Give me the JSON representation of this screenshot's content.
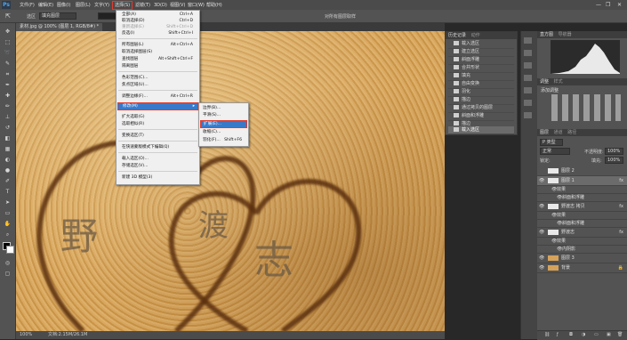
{
  "menubar": {
    "logo": "Ps",
    "items": [
      "文件(F)",
      "编辑(E)",
      "图像(I)",
      "图层(L)",
      "文字(Y)",
      "选择(S)",
      "滤镜(T)",
      "3D(D)",
      "视图(V)",
      "窗口(W)",
      "帮助(H)"
    ],
    "active": "选择(S)",
    "controls": [
      "—",
      "❐",
      "✕"
    ]
  },
  "options": {
    "style_label": "选区",
    "style_value": "填充图层",
    "extra": "对所有图层取样"
  },
  "document": {
    "tab": "素材.jpg @ 100% (图层 1, RGB/8#) *",
    "zoom": "100%",
    "info": "文档:2.15M/26.1M"
  },
  "select_menu": {
    "items": [
      {
        "label": "全部(A)",
        "shortcut": "Ctrl+A"
      },
      {
        "label": "取消选择(D)",
        "shortcut": "Ctrl+D"
      },
      {
        "label": "重新选择(E)",
        "shortcut": "Shift+Ctrl+D",
        "disabled": true
      },
      {
        "label": "反选(I)",
        "shortcut": "Shift+Ctrl+I"
      },
      {
        "label": "所有图层(L)",
        "shortcut": "Alt+Ctrl+A"
      },
      {
        "label": "取消选择图层(S)",
        "shortcut": ""
      },
      {
        "label": "查找图层",
        "shortcut": "Alt+Shift+Ctrl+F"
      },
      {
        "label": "隔离图层",
        "shortcut": ""
      },
      {
        "label": "色彩范围(C)...",
        "shortcut": ""
      },
      {
        "label": "焦点区域(U)...",
        "shortcut": ""
      },
      {
        "label": "调整边缘(F)...",
        "shortcut": "Alt+Ctrl+R"
      },
      {
        "label": "修改(M)",
        "shortcut": "▸"
      },
      {
        "label": "扩大选取(G)",
        "shortcut": ""
      },
      {
        "label": "选取相似(R)",
        "shortcut": ""
      },
      {
        "label": "变换选区(T)",
        "shortcut": ""
      },
      {
        "label": "在快速蒙版模式下编辑(Q)",
        "shortcut": ""
      },
      {
        "label": "载入选区(O)...",
        "shortcut": ""
      },
      {
        "label": "存储选区(V)...",
        "shortcut": ""
      },
      {
        "label": "新建 3D 模型(3)",
        "shortcut": ""
      }
    ]
  },
  "modify_submenu": {
    "items": [
      {
        "label": "边界(B)...",
        "shortcut": ""
      },
      {
        "label": "平滑(S)...",
        "shortcut": ""
      },
      {
        "label": "扩展(E)...",
        "shortcut": ""
      },
      {
        "label": "收缩(C)...",
        "shortcut": ""
      },
      {
        "label": "羽化(F)...",
        "shortcut": "Shift+F6"
      }
    ],
    "highlighted": "扩展(E)..."
  },
  "history": {
    "tabs": [
      "历史记录",
      "动作"
    ],
    "items": [
      "载入选区",
      "建立选区",
      "斜面浮雕",
      "合并形状",
      "填充",
      "自由变换",
      "羽化",
      "描边",
      "通过拷贝的图层",
      "斜面和浮雕",
      "描边",
      "载入选区"
    ],
    "selected": "载入选区"
  },
  "histogram_panel": {
    "tabs": [
      "直方图",
      "导航器"
    ]
  },
  "adjustments_panel": {
    "tabs": [
      "调整",
      "样式"
    ],
    "title": "添加调整"
  },
  "layers_panel": {
    "tabs": [
      "图层",
      "通道",
      "路径"
    ],
    "kind": "P 类型",
    "blend_mode": "正常",
    "opacity_label": "不透明度:",
    "opacity": "100%",
    "lock_label": "锁定:",
    "fill_label": "填充:",
    "fill": "100%",
    "layers": [
      {
        "name": "图层 2",
        "thumb": "white",
        "eye": "",
        "fx": ""
      },
      {
        "name": "图层 1",
        "thumb": "white",
        "eye": "👁",
        "fx": "fx",
        "selected": true
      },
      {
        "name": "效果",
        "thumb": "",
        "eye": "👁",
        "fx": "",
        "indent": 1
      },
      {
        "name": "斜面和浮雕",
        "thumb": "",
        "eye": "👁",
        "fx": "",
        "indent": 2
      },
      {
        "name": "野渡志 拷贝",
        "thumb": "white",
        "eye": "👁",
        "fx": "fx"
      },
      {
        "name": "效果",
        "thumb": "",
        "eye": "👁",
        "fx": "",
        "indent": 1
      },
      {
        "name": "斜面和浮雕",
        "thumb": "",
        "eye": "👁",
        "fx": "",
        "indent": 2
      },
      {
        "name": "野渡志",
        "thumb": "white",
        "eye": "👁",
        "fx": "fx"
      },
      {
        "name": "效果",
        "thumb": "",
        "eye": "👁",
        "fx": "",
        "indent": 1
      },
      {
        "name": "内阴影",
        "thumb": "",
        "eye": "👁",
        "fx": "",
        "indent": 2
      },
      {
        "name": "图层 3",
        "thumb": "sand",
        "eye": "👁",
        "fx": ""
      },
      {
        "name": "背景",
        "thumb": "sand",
        "eye": "👁",
        "fx": "🔒"
      }
    ]
  },
  "canvas_text": {
    "c1": "野",
    "c2": "渡",
    "c3": "志"
  },
  "colors": {
    "highlight": "#3b79c8",
    "outline": "#e23b2e"
  }
}
